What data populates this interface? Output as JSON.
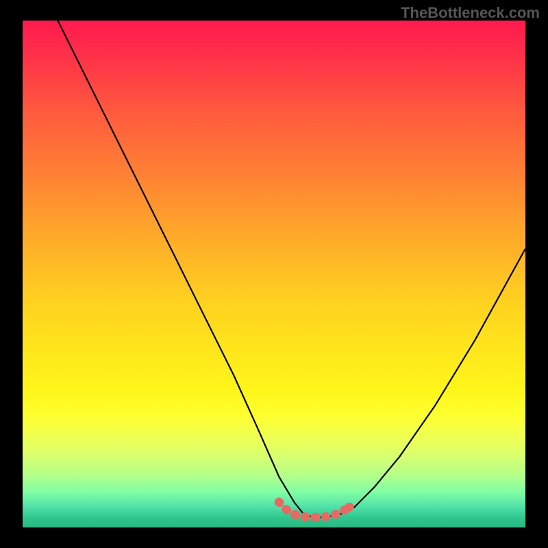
{
  "watermark": "TheBottleneck.com",
  "chart_data": {
    "type": "line",
    "title": "",
    "xlabel": "",
    "ylabel": "",
    "xlim": [
      0,
      100
    ],
    "ylim": [
      0,
      100
    ],
    "background": "heatmap-gradient-red-to-green",
    "series": [
      {
        "name": "curve",
        "color": "#000000",
        "x": [
          7,
          12,
          18,
          24,
          30,
          36,
          42,
          47,
          51,
          54,
          56,
          58,
          60,
          63,
          66,
          70,
          75,
          82,
          90,
          100
        ],
        "y": [
          100,
          90,
          78,
          66,
          54,
          42,
          30,
          19,
          10,
          5,
          2.5,
          2,
          2,
          2.5,
          4,
          8,
          14,
          24,
          37,
          55
        ]
      },
      {
        "name": "highlight",
        "color": "#e66a62",
        "style": "thick-dotted",
        "x": [
          51,
          53,
          55,
          57,
          59,
          61,
          63,
          65
        ],
        "y": [
          5,
          3,
          2.2,
          2,
          2,
          2.2,
          2.8,
          4
        ]
      }
    ],
    "annotations": []
  }
}
